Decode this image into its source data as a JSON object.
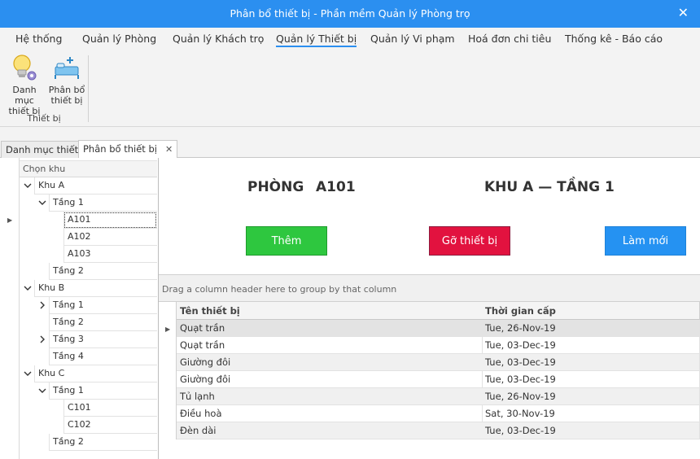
{
  "window": {
    "title": "Phân bổ thiết bị - Phần mềm Quản lý Phòng trọ",
    "close_glyph": "✕"
  },
  "menu": [
    {
      "label": "Hệ thống"
    },
    {
      "label": "Quản lý Phòng"
    },
    {
      "label": "Quản lý Khách trọ"
    },
    {
      "label": "Quản lý Thiết bị",
      "active": true
    },
    {
      "label": "Quản lý Vi phạm"
    },
    {
      "label": "Hoá đơn chi tiêu"
    },
    {
      "label": "Thống kê - Báo cáo"
    }
  ],
  "ribbon": {
    "buttons": [
      {
        "label": "Danh mục thiết bị",
        "line1": "Danh mục",
        "line2": "thiết bị",
        "icon": "lightbulb-gear-icon"
      },
      {
        "label": "Phân bổ thiết bị",
        "line1": "Phân bổ",
        "line2": "thiết bị",
        "icon": "bed-add-icon"
      }
    ],
    "group_label": "Thiết bị"
  },
  "tabs": [
    {
      "label": "Danh mục thiết bị"
    },
    {
      "label": "Phân bổ thiết bị",
      "active": true,
      "close": "✕"
    }
  ],
  "tree": {
    "header": "Chọn khu",
    "rows": [
      {
        "label": "Khu A",
        "level": 0,
        "expander": "down"
      },
      {
        "label": "Tầng 1",
        "level": 1,
        "expander": "down"
      },
      {
        "label": "A101",
        "level": 2,
        "selected": true
      },
      {
        "label": "A102",
        "level": 2
      },
      {
        "label": "A103",
        "level": 2
      },
      {
        "label": "Tầng 2",
        "level": 1
      },
      {
        "label": "Khu B",
        "level": 0,
        "expander": "down"
      },
      {
        "label": "Tầng 1",
        "level": 1,
        "expander": "right"
      },
      {
        "label": "Tầng 2",
        "level": 1
      },
      {
        "label": "Tầng 3",
        "level": 1,
        "expander": "right"
      },
      {
        "label": "Tầng 4",
        "level": 1
      },
      {
        "label": "Khu C",
        "level": 0,
        "expander": "down"
      },
      {
        "label": "Tầng 1",
        "level": 1,
        "expander": "down"
      },
      {
        "label": "C101",
        "level": 2
      },
      {
        "label": "C102",
        "level": 2
      },
      {
        "label": "Tầng 2",
        "level": 1
      }
    ]
  },
  "room": {
    "label": "PHÒNG",
    "code": "A101",
    "location": "KHU A — TẦNG 1"
  },
  "actions": {
    "add": "Thêm",
    "remove": "Gỡ thiết bị",
    "refresh": "Làm mới"
  },
  "colors": {
    "add": "#2ec73f",
    "remove": "#e2123f",
    "refresh": "#2592f2",
    "accent": "#2b8ff0"
  },
  "grid": {
    "group_hint": "Drag a column header here to group by that column",
    "columns": [
      "Tên thiết bị",
      "Thời gian cấp"
    ],
    "rows": [
      [
        "Quạt trần",
        "Tue, 26-Nov-19"
      ],
      [
        "Quạt trần",
        "Tue, 03-Dec-19"
      ],
      [
        "Giường đôi",
        "Tue, 03-Dec-19"
      ],
      [
        "Giường đôi",
        "Tue, 03-Dec-19"
      ],
      [
        "Tủ lạnh",
        "Tue, 26-Nov-19"
      ],
      [
        "Điều hoà",
        "Sat, 30-Nov-19"
      ],
      [
        "Đèn dài",
        "Tue, 03-Dec-19"
      ]
    ]
  }
}
